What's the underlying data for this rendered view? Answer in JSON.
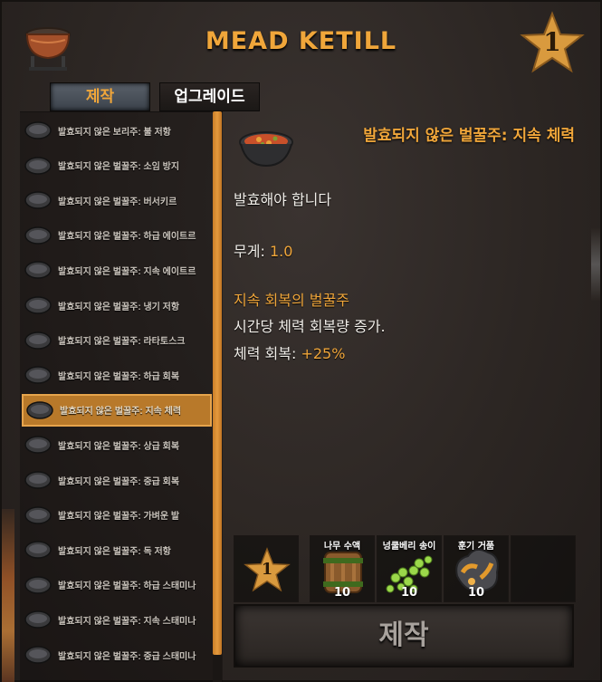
{
  "window": {
    "title": "MEAD KETILL",
    "level": "1"
  },
  "tabs": [
    {
      "label": "제작",
      "active": true
    },
    {
      "label": "업그레이드",
      "active": false
    }
  ],
  "recipes": [
    {
      "label": "발효되지 않은 보리주: 불 저항",
      "selected": false
    },
    {
      "label": "발효되지 않은 벌꿀주: 소임 방지",
      "selected": false
    },
    {
      "label": "발효되지 않은 벌꿀주: 버서키르",
      "selected": false
    },
    {
      "label": "발효되지 않은 벌꿀주: 하급 에이트르",
      "selected": false
    },
    {
      "label": "발효되지 않은 벌꿀주: 지속 에이트르",
      "selected": false
    },
    {
      "label": "발효되지 않은 벌꿀주: 냉기 저항",
      "selected": false
    },
    {
      "label": "발효되지 않은 벌꿀주: 라타토스크",
      "selected": false
    },
    {
      "label": "발효되지 않은 벌꿀주: 하급 회복",
      "selected": false
    },
    {
      "label": "발효되지 않은 벌꿀주: 지속 체력",
      "selected": true
    },
    {
      "label": "발효되지 않은 벌꿀주: 상급 회복",
      "selected": false
    },
    {
      "label": "발효되지 않은 벌꿀주: 중급 회복",
      "selected": false
    },
    {
      "label": "발효되지 않은 벌꿀주: 가벼운 발",
      "selected": false
    },
    {
      "label": "발효되지 않은 벌꿀주: 독 저항",
      "selected": false
    },
    {
      "label": "발효되지 않은 벌꿀주: 하급 스태미나",
      "selected": false
    },
    {
      "label": "발효되지 않은 벌꿀주: 지속 스태미나",
      "selected": false
    },
    {
      "label": "발효되지 않은 벌꿀주: 중급 스태미나",
      "selected": false
    }
  ],
  "detail": {
    "title": "발효되지 않은 벌꿀주: 지속 체력",
    "note": "발효해야 합니다",
    "weight_label": "무게:",
    "weight_value": "1.0",
    "effect_name": "지속 회복의 벌꿀주",
    "effect_desc": "시간당 체력 회복량 증가.",
    "stat_label": "체력 회복:",
    "stat_value": "+25%"
  },
  "requirements": {
    "station_level": "1",
    "items": [
      {
        "name": "나무 수액",
        "amount": "10",
        "icon": "sap-barrel-icon"
      },
      {
        "name": "넝쿨베리 송이",
        "amount": "10",
        "icon": "vineberry-icon"
      },
      {
        "name": "훈기 거품",
        "amount": "10",
        "icon": "smoke-puff-icon"
      }
    ]
  },
  "craft_button": {
    "label": "제작"
  },
  "colors": {
    "accent": "#f0a63a",
    "selected_row": "#b8792a",
    "background": "#2c2623"
  }
}
